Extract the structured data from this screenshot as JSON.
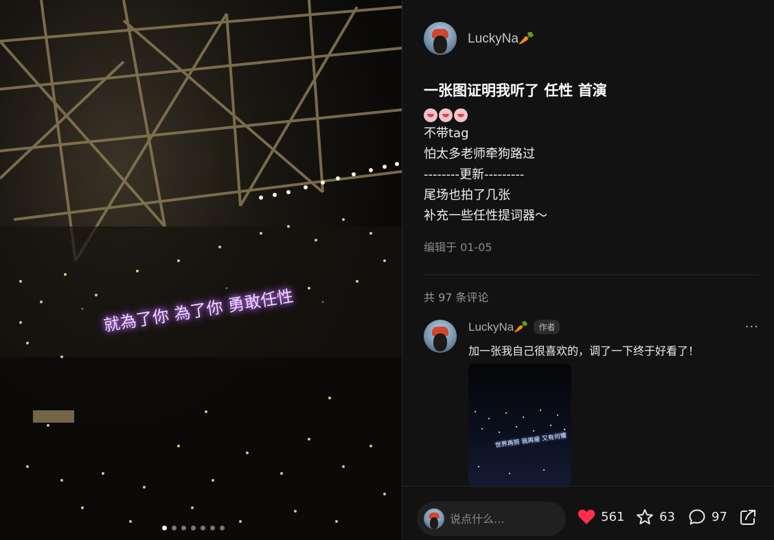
{
  "photo": {
    "overlay_text": "就為了你 為了你 勇敢任性",
    "carousel": {
      "count": 7,
      "active_index": 0
    }
  },
  "post": {
    "author": {
      "name": "LuckyNa🥕"
    },
    "title": "一张图证明我听了 任性 首演",
    "body_lines": [
      "不带tag",
      "怕太多老师牵狗路过",
      "--------更新---------",
      "尾场也拍了几张",
      "补充一些任性提词器～"
    ],
    "edited": "编辑于 01-05",
    "comment_count": "共 97 条评论"
  },
  "comment": {
    "name": "LuckyNa🥕",
    "badge": "作者",
    "more": "···",
    "text": "加一张我自己很喜欢的，调了一下终于好看了！",
    "image_overlay_text": "世界再努 我再瘦 又有何懼"
  },
  "footer": {
    "input_placeholder": "说点什么...",
    "likes": "561",
    "favorites": "63",
    "comments": "97"
  },
  "colors": {
    "like": "#ff2e4d",
    "panel_bg": "#121212",
    "text_muted": "#8a8a8a"
  }
}
